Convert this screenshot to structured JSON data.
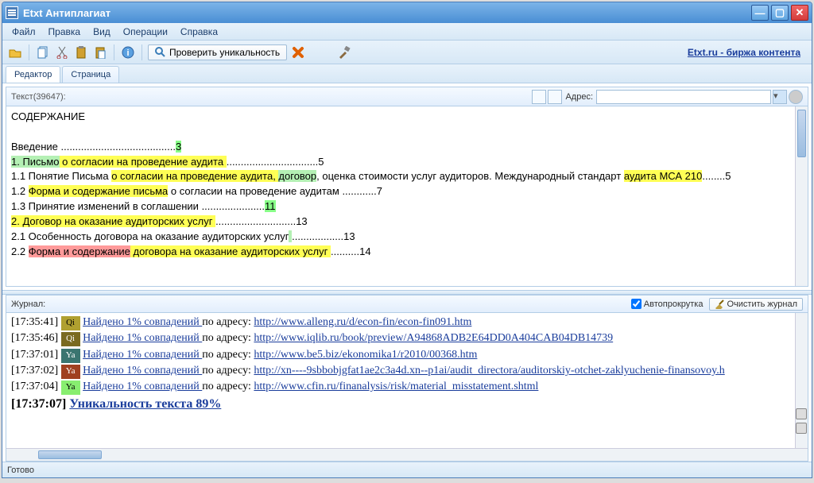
{
  "window": {
    "title": "Etxt Антиплагиат"
  },
  "menu": {
    "file": "Файл",
    "edit": "Правка",
    "view": "Вид",
    "ops": "Операции",
    "help": "Справка"
  },
  "toolbar": {
    "check": "Проверить уникальность",
    "link": "Etxt.ru - биржа контента"
  },
  "tabs": {
    "editor": "Редактор",
    "page": "Страница"
  },
  "edheader": {
    "textlabel": "Текст(39647):",
    "addr": "Адрес:"
  },
  "doc": {
    "heading": "СОДЕРЖАНИЕ",
    "l0_a": "Введение ",
    "l0_b": "3",
    "l1_a": "1. Письмо",
    "l1_b": " о согласии на проведение аудита ",
    "l1_c": "5",
    "l2_a": "1.1 Понятие Письма ",
    "l2_b": "о согласии на проведение аудита, ",
    "l2_c": "договор",
    "l2_d": ", оценка стоимости услуг аудиторов. Международный стандарт ",
    "l2_e": "аудита МСА 210",
    "l2_f": "5",
    "l3_a": "1.2 ",
    "l3_b": "Форма и содержание письма",
    "l3_c": " о согласии на проведение аудитам ",
    "l3_d": "7",
    "l4_a": "1.3 Принятие изменений в соглашении ",
    "l4_b": "11",
    "l5_a": "2. Договор на оказание аудиторских услуг ",
    "l5_b": "13",
    "l6_a": "2.1 Особенность договора на оказание аудиторских услуг",
    "l6_b": " ",
    "l6_c": "13",
    "l7_a": "2.2 ",
    "l7_b": "Форма и содержание",
    "l7_c": " договора на оказание аудиторских услуг ",
    "l7_d": "14"
  },
  "log": {
    "title": "Журнал:",
    "autoscroll": "Автопрокрутка",
    "clear": "Очистить журнал",
    "found": "Найдено 1% совпадений ",
    "byaddr": "по адресу: ",
    "rows": [
      {
        "time": "[17:35:41]",
        "badgecls": "b-olive",
        "badge": "Qi",
        "url": "http://www.alleng.ru/d/econ-fin/econ-fin091.htm"
      },
      {
        "time": "[17:35:46]",
        "badgecls": "b-dark",
        "badge": "Qi",
        "url": "http://www.iqlib.ru/book/preview/A94868ADB2E64DD0A404CAB04DB14739"
      },
      {
        "time": "[17:37:01]",
        "badgecls": "b-teal",
        "badge": "Ya",
        "url": "http://www.be5.biz/ekonomika1/r2010/00368.htm"
      },
      {
        "time": "[17:37:02]",
        "badgecls": "b-brown",
        "badge": "Ya",
        "url": "http://xn----9sbbobjgfat1ae2c3a4d.xn--p1ai/audit_directora/auditorskiy-otchet-zaklyuchenie-finansovoy.h"
      },
      {
        "time": "[17:37:04]",
        "badgecls": "b-lime",
        "badge": "Ya",
        "url": "http://www.cfin.ru/finanalysis/risk/material_misstatement.shtml"
      }
    ],
    "result_time": "[17:37:07] ",
    "result_text": "Уникальность текста 89%"
  },
  "status": "Готово"
}
